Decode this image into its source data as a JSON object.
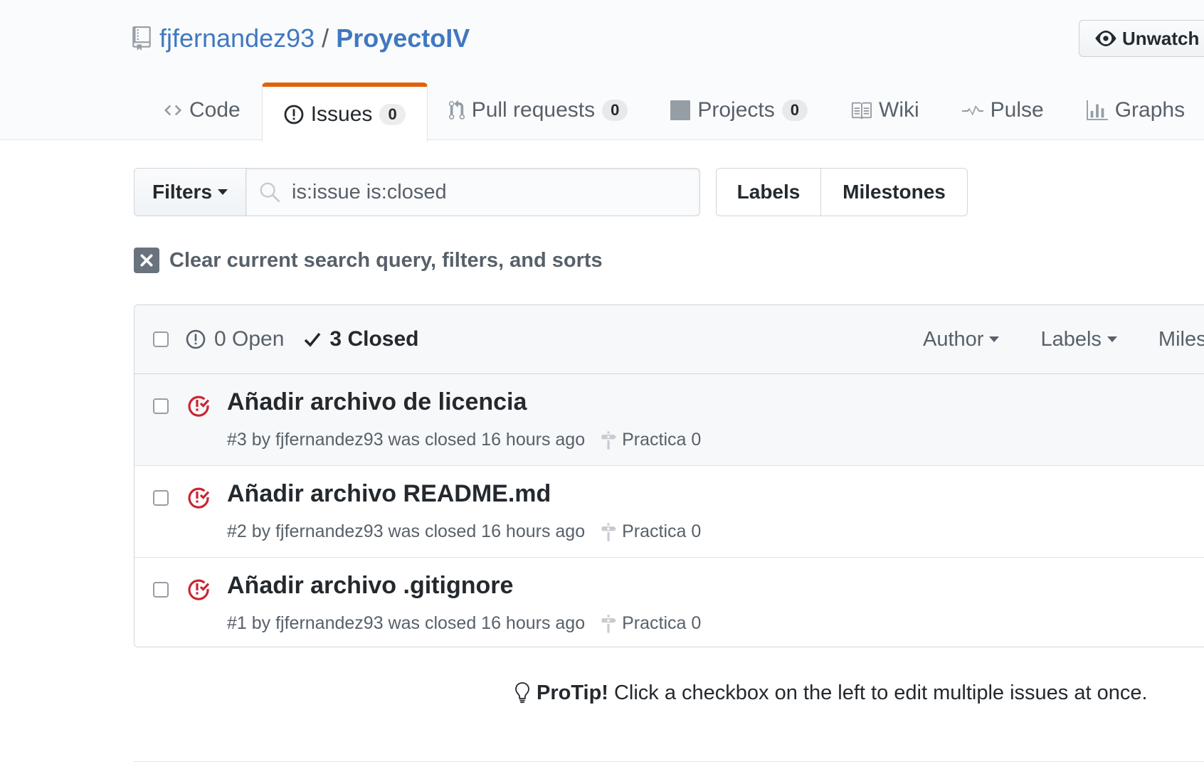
{
  "repo": {
    "owner": "fjfernandez93",
    "separator": "/",
    "name": "ProyectoIV",
    "watch_label": "Unwatch"
  },
  "nav": {
    "code": "Code",
    "issues": "Issues",
    "issues_count": "0",
    "pull_requests": "Pull requests",
    "pull_requests_count": "0",
    "projects": "Projects",
    "projects_count": "0",
    "wiki": "Wiki",
    "pulse": "Pulse",
    "graphs": "Graphs"
  },
  "subnav": {
    "filters_label": "Filters",
    "search_value": "is:issue is:closed",
    "labels_label": "Labels",
    "milestones_label": "Milestones"
  },
  "clear_query": "Clear current search query, filters, and sorts",
  "issues_header": {
    "open_label": "0 Open",
    "closed_label": "3 Closed",
    "author_filter": "Author",
    "labels_filter": "Labels",
    "milestones_filter": "Miles"
  },
  "issues": [
    {
      "title": "Añadir archivo de licencia",
      "meta": "#3 by fjfernandez93 was closed 16 hours ago",
      "milestone": "Practica 0"
    },
    {
      "title": "Añadir archivo README.md",
      "meta": "#2 by fjfernandez93 was closed 16 hours ago",
      "milestone": "Practica 0"
    },
    {
      "title": "Añadir archivo .gitignore",
      "meta": "#1 by fjfernandez93 was closed 16 hours ago",
      "milestone": "Practica 0"
    }
  ],
  "protip": {
    "label": "ProTip!",
    "text": "Click a checkbox on the left to edit multiple issues at once."
  },
  "colors": {
    "link_blue": "#4078c0",
    "closed_red": "#cb2431",
    "selected_tab_accent": "#e36209"
  }
}
